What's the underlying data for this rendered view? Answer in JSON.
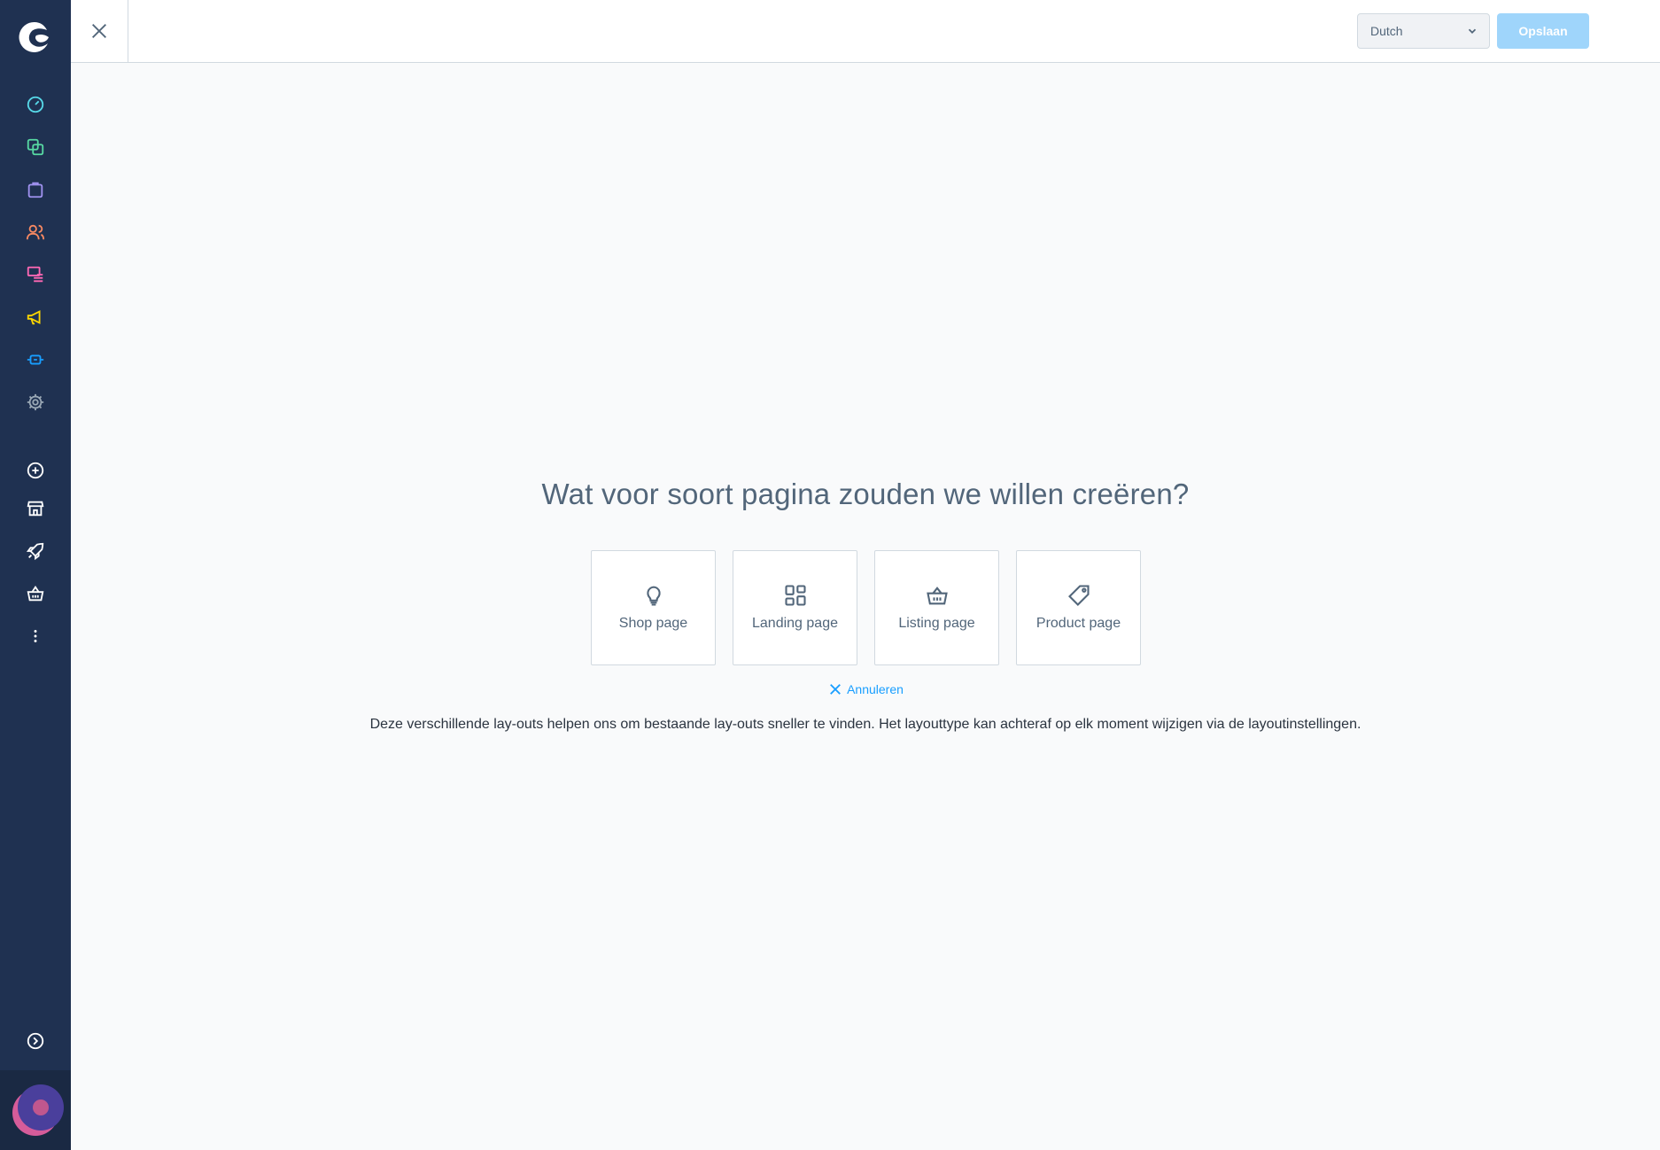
{
  "header": {
    "language": "Dutch",
    "save_label": "Opslaan"
  },
  "main": {
    "headline": "Wat voor soort pagina zouden we willen creëren?",
    "page_types": [
      {
        "label": "Shop page",
        "icon": "lightbulb-icon"
      },
      {
        "label": "Landing page",
        "icon": "layout-grid-icon"
      },
      {
        "label": "Listing page",
        "icon": "basket-icon"
      },
      {
        "label": "Product page",
        "icon": "tag-icon"
      }
    ],
    "cancel_label": "Annuleren",
    "hint": "Deze verschillende lay-outs helpen ons om bestaande lay-outs sneller te vinden. Het layouttype kan achteraf op elk moment wijzigen via de layoutinstellingen."
  },
  "sidebar": {
    "items": [
      {
        "icon": "dashboard-icon",
        "color": "#57d9e8"
      },
      {
        "icon": "catalogues-icon",
        "color": "#57d9a3"
      },
      {
        "icon": "orders-icon",
        "color": "#a092f0"
      },
      {
        "icon": "customers-icon",
        "color": "#f88962"
      },
      {
        "icon": "content-icon",
        "color": "#ff68b4"
      },
      {
        "icon": "marketing-icon",
        "color": "#ffd700"
      },
      {
        "icon": "extensions-icon",
        "color": "#189eff"
      },
      {
        "icon": "settings-icon",
        "color": "#9aa8b5"
      },
      {
        "icon": "add-sales-channel-icon",
        "color": "#ffffff"
      },
      {
        "icon": "storefront-icon",
        "color": "#ffffff"
      },
      {
        "icon": "rocket-icon",
        "color": "#ffffff"
      },
      {
        "icon": "basket-icon",
        "color": "#ffffff"
      },
      {
        "icon": "more-icon",
        "color": "#ffffff"
      },
      {
        "icon": "collapse-icon",
        "color": "#ffffff"
      }
    ]
  },
  "colors": {
    "sidebar_bg": "#1f3151",
    "accent": "#189eff",
    "save_disabled": "#9fd5fb"
  }
}
